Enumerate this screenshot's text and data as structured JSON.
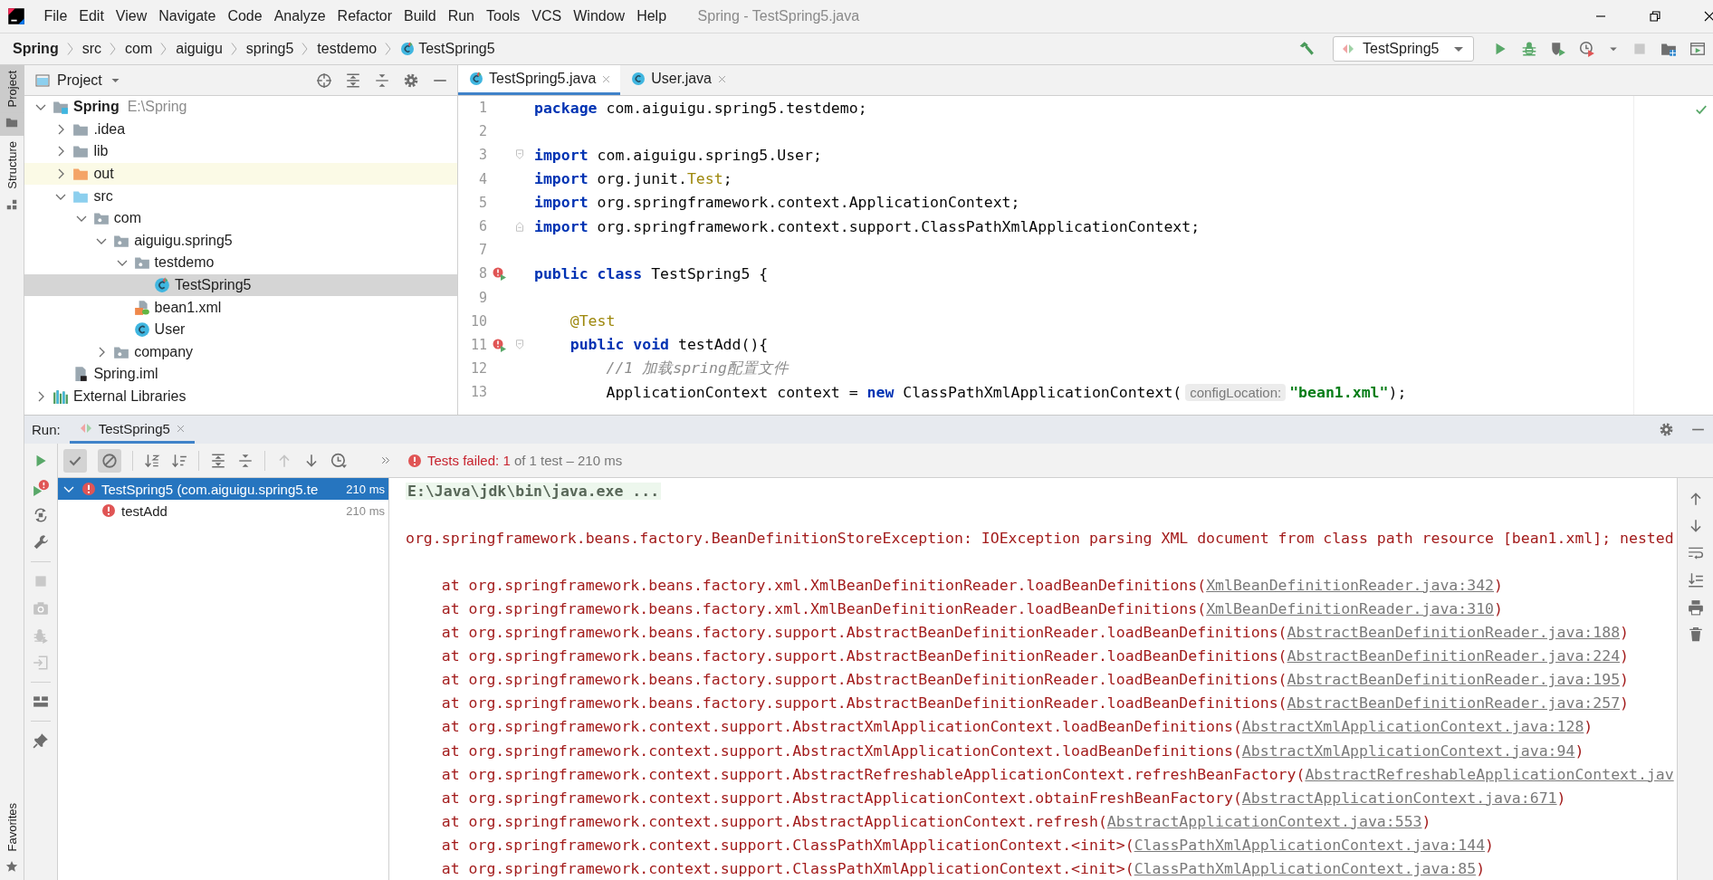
{
  "window": {
    "title": "Spring - TestSpring5.java"
  },
  "menu": [
    "File",
    "Edit",
    "View",
    "Navigate",
    "Code",
    "Analyze",
    "Refactor",
    "Build",
    "Run",
    "Tools",
    "VCS",
    "Window",
    "Help"
  ],
  "breadcrumbs": [
    {
      "label": "Spring",
      "kind": "project"
    },
    {
      "label": "src",
      "kind": "dir"
    },
    {
      "label": "com",
      "kind": "dir"
    },
    {
      "label": "aiguigu",
      "kind": "dir"
    },
    {
      "label": "spring5",
      "kind": "dir"
    },
    {
      "label": "testdemo",
      "kind": "dir"
    },
    {
      "label": "TestSpring5",
      "kind": "test-class"
    }
  ],
  "run_config": {
    "label": "TestSpring5"
  },
  "tool_strip": [
    {
      "label": "Project",
      "selected": true
    },
    {
      "label": "Structure",
      "selected": false
    }
  ],
  "favorites": {
    "label": "Favorites"
  },
  "project_panel": {
    "title": "Project",
    "tree": [
      {
        "label": "Spring",
        "path": "E:\\Spring",
        "kind": "module",
        "expanded": true,
        "selected": false,
        "highlighted": false,
        "children": [
          {
            "label": ".idea",
            "kind": "folder",
            "expanded": false,
            "selected": false,
            "highlighted": false
          },
          {
            "label": "lib",
            "kind": "folder",
            "expanded": false,
            "selected": false,
            "highlighted": false
          },
          {
            "label": "out",
            "kind": "folder-out",
            "expanded": false,
            "selected": false,
            "highlighted": true
          },
          {
            "label": "src",
            "kind": "folder-src",
            "expanded": true,
            "selected": false,
            "highlighted": false,
            "children": [
              {
                "label": "com",
                "kind": "package",
                "expanded": true,
                "selected": false,
                "highlighted": false,
                "children": [
                  {
                    "label": "aiguigu.spring5",
                    "kind": "package",
                    "expanded": true,
                    "selected": false,
                    "highlighted": false,
                    "children": [
                      {
                        "label": "testdemo",
                        "kind": "package",
                        "expanded": true,
                        "selected": false,
                        "highlighted": false,
                        "children": [
                          {
                            "label": "TestSpring5",
                            "kind": "test-class",
                            "selected": true,
                            "highlighted": false
                          }
                        ]
                      },
                      {
                        "label": "bean1.xml",
                        "kind": "xml",
                        "selected": false,
                        "highlighted": false
                      },
                      {
                        "label": "User",
                        "kind": "class",
                        "selected": false,
                        "highlighted": false
                      }
                    ]
                  },
                  {
                    "label": "company",
                    "kind": "package",
                    "expanded": false,
                    "selected": false,
                    "highlighted": false
                  }
                ]
              }
            ]
          },
          {
            "label": "Spring.iml",
            "kind": "iml",
            "selected": false,
            "highlighted": false
          }
        ]
      },
      {
        "label": "External Libraries",
        "kind": "libraries",
        "expanded": false,
        "selected": false,
        "highlighted": false
      }
    ]
  },
  "editor": {
    "tabs": [
      {
        "label": "TestSpring5.java",
        "kind": "test-class",
        "selected": true
      },
      {
        "label": "User.java",
        "kind": "class",
        "selected": false
      }
    ],
    "lines": [
      {
        "number": "1",
        "run_marker": false,
        "fold_start": false,
        "fold_end": false,
        "tokens": [
          {
            "text": "package",
            "kind": "kw"
          },
          {
            "text": " com.aiguigu.spring5.testdemo;",
            "kind": "plain"
          }
        ]
      },
      {
        "number": "2",
        "run_marker": false,
        "fold_start": false,
        "fold_end": false
      },
      {
        "number": "3",
        "run_marker": false,
        "fold_start": true,
        "fold_end": false,
        "tokens": [
          {
            "text": "import",
            "kind": "kw"
          },
          {
            "text": " com.aiguigu.spring5.User;",
            "kind": "plain"
          }
        ]
      },
      {
        "number": "4",
        "run_marker": false,
        "fold_start": false,
        "fold_end": false,
        "tokens": [
          {
            "text": "import",
            "kind": "kw"
          },
          {
            "text": " org.junit.",
            "kind": "plain"
          },
          {
            "text": "Test",
            "kind": "olive"
          },
          {
            "text": ";",
            "kind": "plain"
          }
        ]
      },
      {
        "number": "5",
        "run_marker": false,
        "fold_start": false,
        "fold_end": false,
        "tokens": [
          {
            "text": "import",
            "kind": "kw"
          },
          {
            "text": " org.springframework.context.ApplicationContext;",
            "kind": "plain"
          }
        ]
      },
      {
        "number": "6",
        "run_marker": false,
        "fold_start": false,
        "fold_end": true,
        "tokens": [
          {
            "text": "import",
            "kind": "kw"
          },
          {
            "text": " org.springframework.context.support.ClassPathXmlApplicationContext;",
            "kind": "plain"
          }
        ]
      },
      {
        "number": "7",
        "run_marker": false,
        "fold_start": false,
        "fold_end": false
      },
      {
        "number": "8",
        "run_marker": true,
        "fold_start": false,
        "fold_end": false,
        "tokens": [
          {
            "text": "public class",
            "kind": "kw"
          },
          {
            "text": " TestSpring5 {",
            "kind": "plain"
          }
        ]
      },
      {
        "number": "9",
        "run_marker": false,
        "fold_start": false,
        "fold_end": false
      },
      {
        "number": "10",
        "run_marker": false,
        "fold_start": false,
        "fold_end": false,
        "tokens": [
          {
            "text": "    @Test",
            "kind": "olive"
          }
        ]
      },
      {
        "number": "11",
        "run_marker": true,
        "fold_start": true,
        "fold_end": false,
        "tokens": [
          {
            "text": "    public void",
            "kind": "kw"
          },
          {
            "text": " testAdd(){",
            "kind": "plain"
          }
        ]
      },
      {
        "number": "12",
        "run_marker": false,
        "fold_start": false,
        "fold_end": false,
        "tokens": [
          {
            "text": "        //1 加载spring配置文件",
            "kind": "comment"
          }
        ]
      },
      {
        "number": "13",
        "run_marker": false,
        "fold_start": false,
        "fold_end": false,
        "tokens": [
          {
            "text": "        ApplicationContext context = ",
            "kind": "plain"
          },
          {
            "text": "new",
            "kind": "kw"
          },
          {
            "text": " ClassPathXmlApplicationContext(",
            "kind": "plain"
          },
          {
            "text": "configLocation:",
            "kind": "hint"
          },
          {
            "text": "\"bean1.xml\"",
            "kind": "str"
          },
          {
            "text": ");",
            "kind": "plain"
          }
        ]
      }
    ]
  },
  "run_panel": {
    "label": "Run:",
    "tabs": [
      {
        "label": "TestSpring5",
        "selected": true
      }
    ],
    "toggles": [
      {
        "kind": "passed",
        "on": true
      },
      {
        "kind": "ignored",
        "on": true
      }
    ],
    "status": {
      "failed_label": "Tests failed:",
      "failed_count": "1",
      "summary": "of 1 test – 210 ms"
    },
    "tests": [
      {
        "label": "TestSpring5 (com.aiguigu.spring5.te",
        "time": "210 ms",
        "selected": true,
        "expanded": true,
        "children": [
          {
            "label": "testAdd",
            "time": "210 ms",
            "selected": false
          }
        ]
      }
    ],
    "console": [
      {
        "kind": "command",
        "text": "E:\\Java\\jdk\\bin\\java.exe ..."
      },
      {
        "kind": "blank"
      },
      {
        "kind": "error",
        "text": "org.springframework.beans.factory.BeanDefinitionStoreException: IOException parsing XML document from class path resource [bean1.xml]; nested"
      },
      {
        "kind": "blank"
      },
      {
        "kind": "frame",
        "text": "at org.springframework.beans.factory.xml.XmlBeanDefinitionReader.loadBeanDefinitions(",
        "link": "XmlBeanDefinitionReader.java:342",
        "end": ")"
      },
      {
        "kind": "frame",
        "text": "at org.springframework.beans.factory.xml.XmlBeanDefinitionReader.loadBeanDefinitions(",
        "link": "XmlBeanDefinitionReader.java:310",
        "end": ")"
      },
      {
        "kind": "frame",
        "text": "at org.springframework.beans.factory.support.AbstractBeanDefinitionReader.loadBeanDefinitions(",
        "link": "AbstractBeanDefinitionReader.java:188",
        "end": ")"
      },
      {
        "kind": "frame",
        "text": "at org.springframework.beans.factory.support.AbstractBeanDefinitionReader.loadBeanDefinitions(",
        "link": "AbstractBeanDefinitionReader.java:224",
        "end": ")"
      },
      {
        "kind": "frame",
        "text": "at org.springframework.beans.factory.support.AbstractBeanDefinitionReader.loadBeanDefinitions(",
        "link": "AbstractBeanDefinitionReader.java:195",
        "end": ")"
      },
      {
        "kind": "frame",
        "text": "at org.springframework.beans.factory.support.AbstractBeanDefinitionReader.loadBeanDefinitions(",
        "link": "AbstractBeanDefinitionReader.java:257",
        "end": ")"
      },
      {
        "kind": "frame",
        "text": "at org.springframework.context.support.AbstractXmlApplicationContext.loadBeanDefinitions(",
        "link": "AbstractXmlApplicationContext.java:128",
        "end": ")"
      },
      {
        "kind": "frame",
        "text": "at org.springframework.context.support.AbstractXmlApplicationContext.loadBeanDefinitions(",
        "link": "AbstractXmlApplicationContext.java:94",
        "end": ")"
      },
      {
        "kind": "frame",
        "text": "at org.springframework.context.support.AbstractRefreshableApplicationContext.refreshBeanFactory(",
        "link": "AbstractRefreshableApplicationContext.jav"
      },
      {
        "kind": "frame",
        "text": "at org.springframework.context.support.AbstractApplicationContext.obtainFreshBeanFactory(",
        "link": "AbstractApplicationContext.java:671",
        "end": ")"
      },
      {
        "kind": "frame",
        "text": "at org.springframework.context.support.AbstractApplicationContext.refresh(",
        "link": "AbstractApplicationContext.java:553",
        "end": ")"
      },
      {
        "kind": "frame",
        "text": "at org.springframework.context.support.ClassPathXmlApplicationContext.<init>(",
        "link": "ClassPathXmlApplicationContext.java:144",
        "end": ")"
      },
      {
        "kind": "frame",
        "text": "at org.springframework.context.support.ClassPathXmlApplicationContext.<init>(",
        "link": "ClassPathXmlApplicationContext.java:85",
        "end": ")"
      }
    ]
  }
}
